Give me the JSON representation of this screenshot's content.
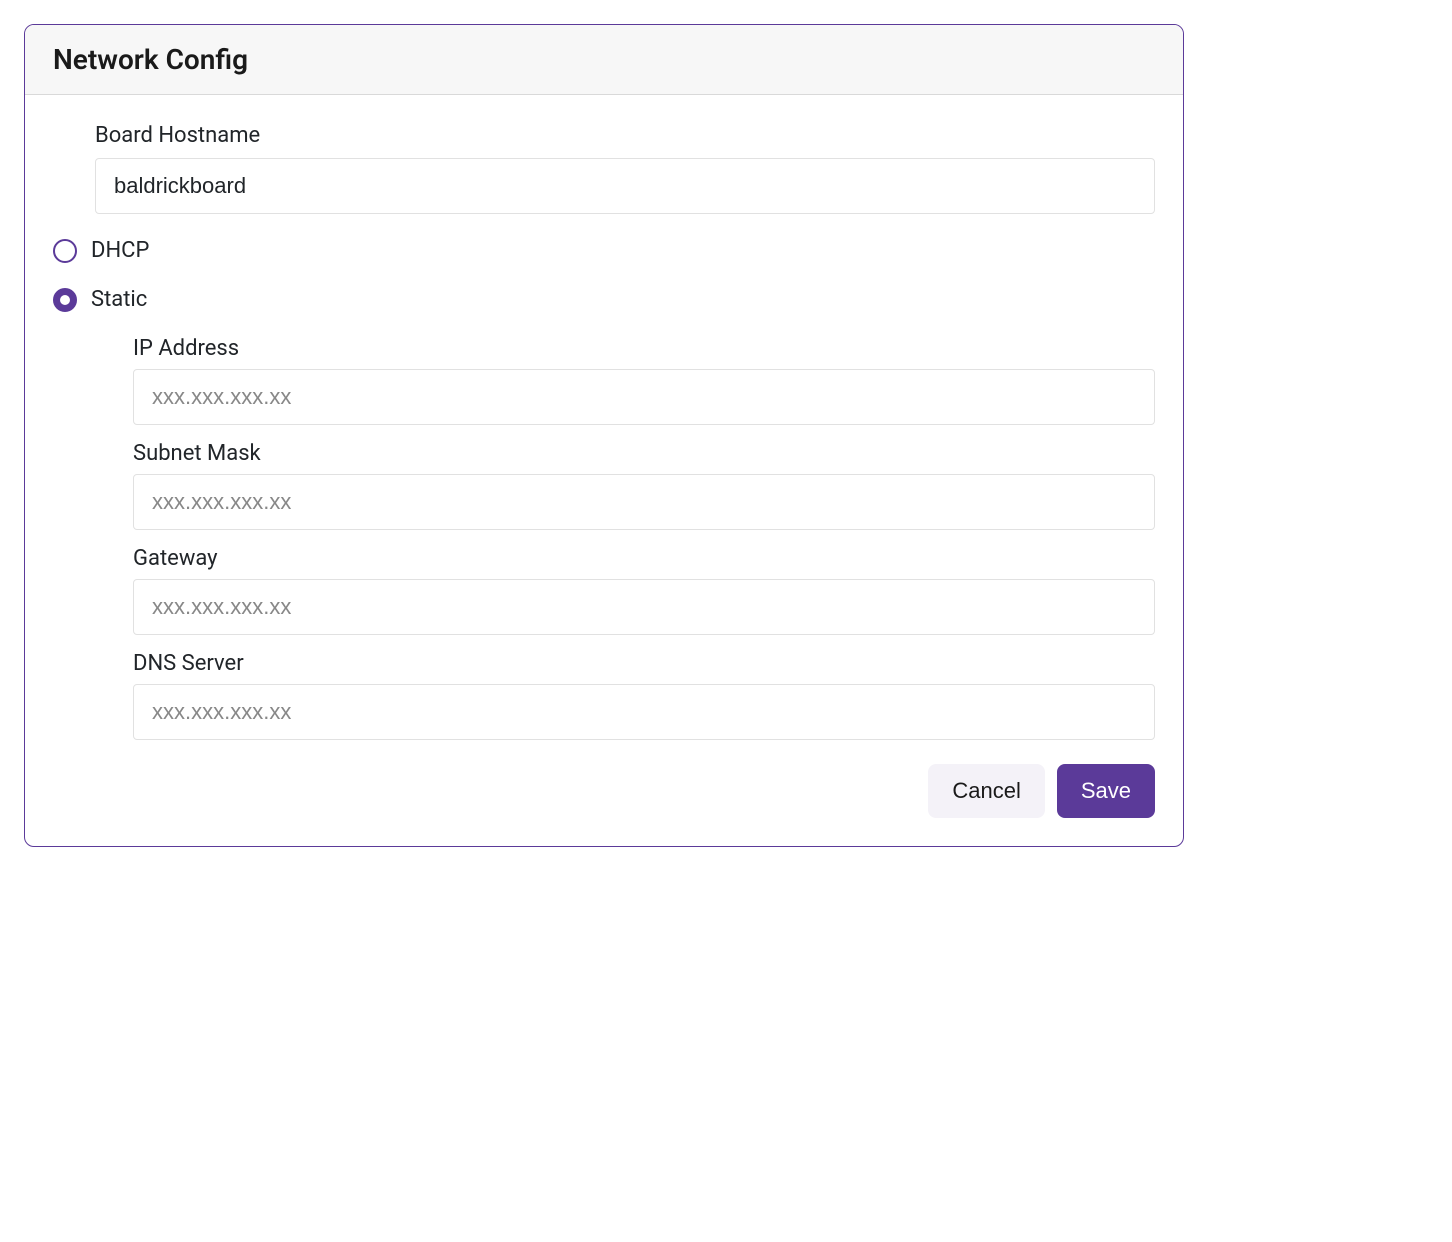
{
  "panel": {
    "title": "Network Config"
  },
  "hostname": {
    "label": "Board Hostname",
    "value": "baldrickboard"
  },
  "mode": {
    "dhcp_label": "DHCP",
    "static_label": "Static",
    "selected": "static"
  },
  "static": {
    "ip": {
      "label": "IP Address",
      "placeholder": "xxx.xxx.xxx.xx",
      "value": ""
    },
    "subnet": {
      "label": "Subnet Mask",
      "placeholder": "xxx.xxx.xxx.xx",
      "value": ""
    },
    "gateway": {
      "label": "Gateway",
      "placeholder": "xxx.xxx.xxx.xx",
      "value": ""
    },
    "dns": {
      "label": "DNS Server",
      "placeholder": "xxx.xxx.xxx.xx",
      "value": ""
    }
  },
  "buttons": {
    "cancel": "Cancel",
    "save": "Save"
  },
  "colors": {
    "accent": "#5b3a99",
    "cancel_bg": "#f4f2f8",
    "border": "#e1e1e1",
    "header_bg": "#f7f7f7"
  }
}
